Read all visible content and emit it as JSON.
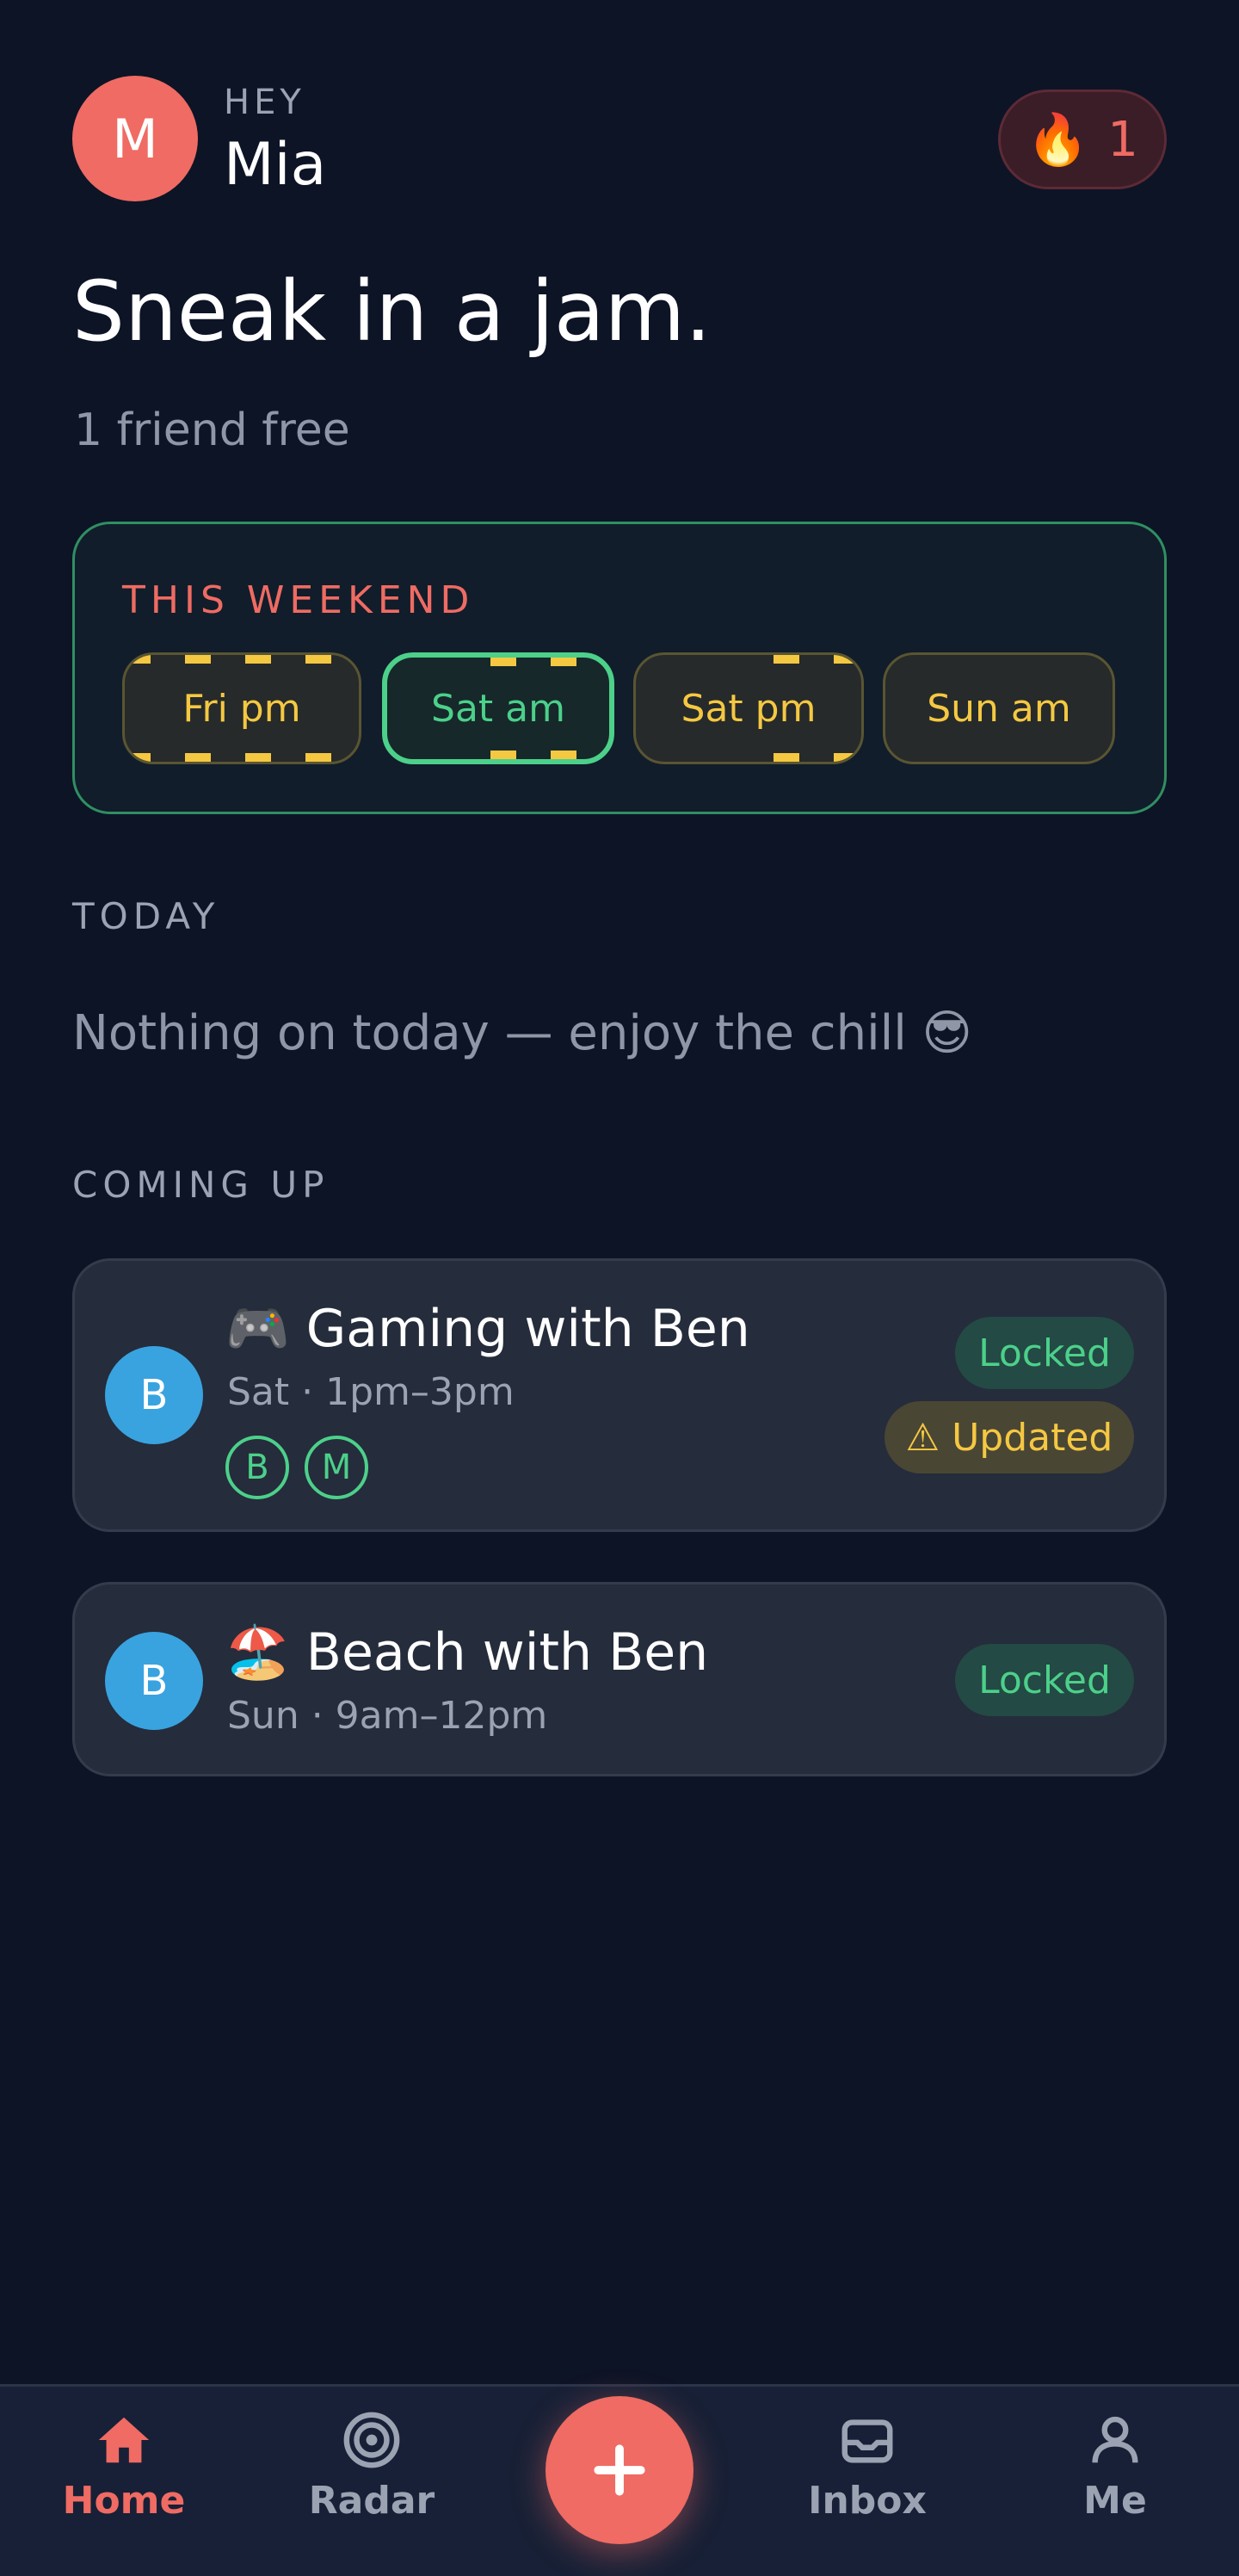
{
  "header": {
    "avatar_initial": "M",
    "greeting": "HEY",
    "user_name": "Mia",
    "streak_icon": "🔥",
    "streak_count": "1"
  },
  "hero": {
    "headline": "Sneak in a jam.",
    "subline": "1 friend free"
  },
  "weekend": {
    "label": "THIS WEEKEND",
    "slots": [
      {
        "label": "Fri pm",
        "state": "tentative"
      },
      {
        "label": "Sat am",
        "state": "selected"
      },
      {
        "label": "Sat pm",
        "state": "tentative"
      },
      {
        "label": "Sun am",
        "state": "open"
      }
    ]
  },
  "today": {
    "label": "TODAY",
    "empty_text": "Nothing on today — enjoy the chill 😎"
  },
  "coming_up": {
    "label": "COMING UP",
    "events": [
      {
        "avatar_initial": "B",
        "title": "🎮 Gaming with Ben",
        "time": "Sat · 1pm–3pm",
        "status": "Locked",
        "update_badge": "⚠ Updated",
        "participants": [
          "B",
          "M"
        ]
      },
      {
        "avatar_initial": "B",
        "title": "🏖️ Beach with Ben",
        "time": "Sun · 9am–12pm",
        "status": "Locked"
      }
    ]
  },
  "nav": {
    "items": [
      {
        "label": "Home",
        "icon": "home-icon",
        "active": true
      },
      {
        "label": "Radar",
        "icon": "radar-icon"
      },
      {
        "label": "Inbox",
        "icon": "inbox-icon"
      },
      {
        "label": "Me",
        "icon": "person-icon"
      }
    ],
    "fab_icon": "plus-icon"
  },
  "colors": {
    "background": "#0d1426",
    "accent": "#ef6b63",
    "success": "#4cd08a",
    "warning": "#f5c842",
    "avatar_friend": "#39a3e0"
  }
}
